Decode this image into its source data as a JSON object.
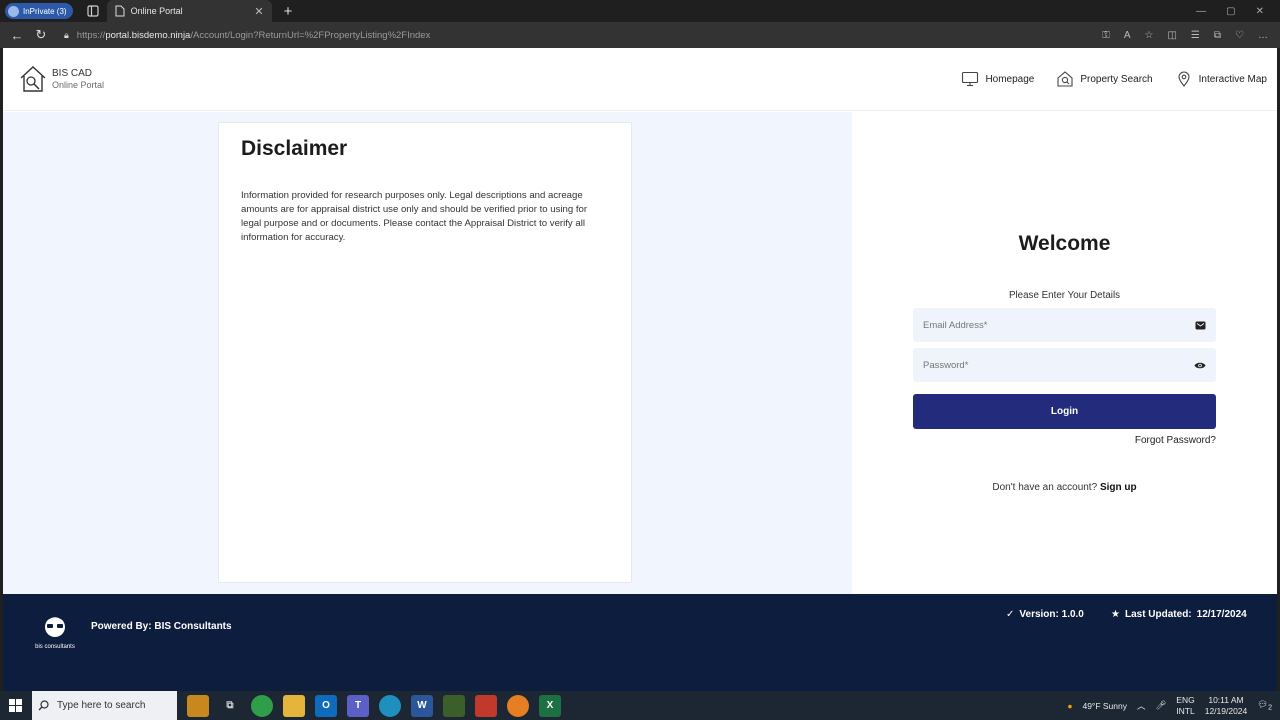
{
  "browser": {
    "inprivate_label": "InPrivate (3)",
    "tab_title": "Online Portal",
    "url_scheme": "https://",
    "url_host": "portal.bisdemo.ninja",
    "url_path": "/Account/Login?ReturnUrl=%2FPropertyListing%2FIndex"
  },
  "header": {
    "brand_name": "BIS CAD",
    "brand_sub": "Online Portal",
    "nav": [
      {
        "label": "Homepage",
        "icon": "monitor-icon"
      },
      {
        "label": "Property Search",
        "icon": "search-house-icon"
      },
      {
        "label": "Interactive Map",
        "icon": "map-pin-icon"
      }
    ]
  },
  "disclaimer": {
    "title": "Disclaimer",
    "text": "Information provided for research purposes only. Legal descriptions and acreage amounts are for appraisal district use only and should be verified prior to using for legal purpose and or documents. Please contact the Appraisal District to verify all information for accuracy."
  },
  "login": {
    "title": "Welcome",
    "subtitle": "Please Enter Your Details",
    "email_placeholder": "Email Address*",
    "password_placeholder": "Password*",
    "login_button": "Login",
    "forgot_password": "Forgot Password?",
    "no_account": "Don't have an account?",
    "sign_up": "Sign up"
  },
  "footer": {
    "powered_by": "Powered By: BIS Consultants",
    "logo_text": "bis consultants",
    "version": "Version: 1.0.0",
    "last_updated_label": "Last Updated:",
    "last_updated": "12/17/2024"
  },
  "taskbar": {
    "search_placeholder": "Type here to search",
    "weather": "49°F  Sunny",
    "lang_1": "ENG",
    "lang_2": "INTL",
    "time": "10:11 AM",
    "date": "12/19/2024",
    "notification_count": "2"
  },
  "colors": {
    "primary_button": "#232c7c",
    "footer_bg": "#0d1d3d",
    "left_panel_bg": "#f1f5fd"
  }
}
